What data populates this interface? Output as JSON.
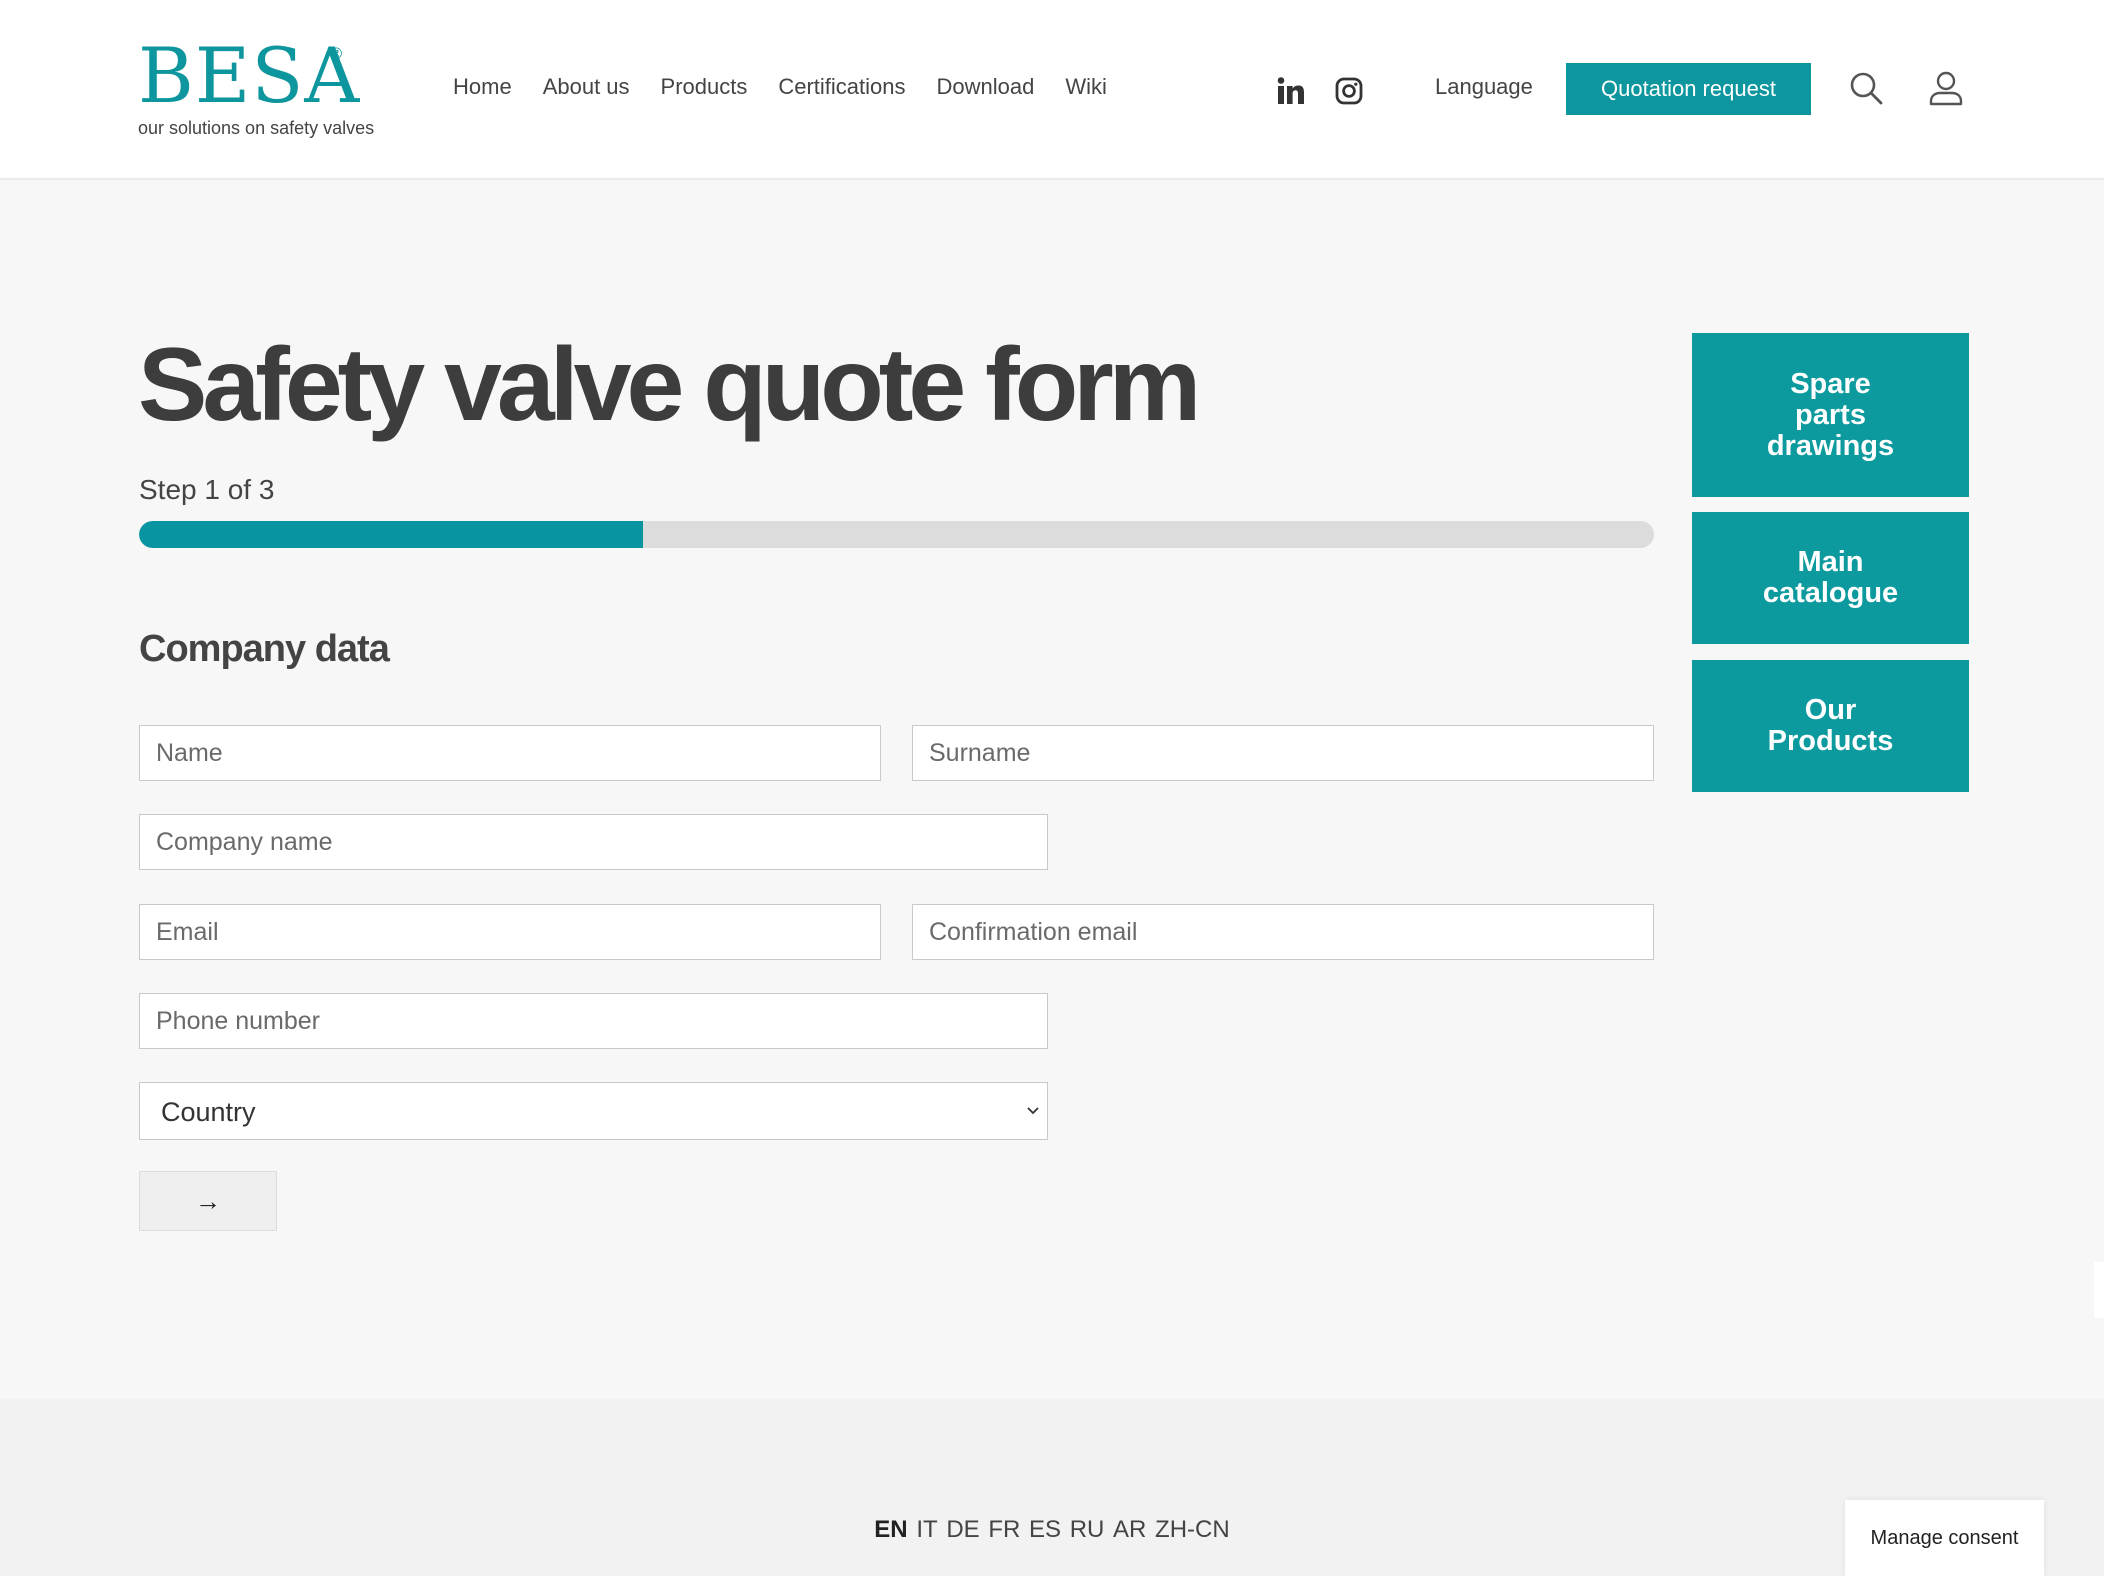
{
  "brand": {
    "name": "BESA",
    "reg": "®",
    "tagline": "our solutions on safety valves",
    "color": "#0d969d"
  },
  "nav": {
    "items": [
      "Home",
      "About us",
      "Products",
      "Certifications",
      "Download",
      "Wiki"
    ]
  },
  "social": {
    "icons": [
      "linkedin-icon",
      "instagram-icon"
    ]
  },
  "header": {
    "language_label": "Language",
    "quote_button": "Quotation request"
  },
  "form": {
    "title": "Safety valve quote form",
    "step_label": "Step 1 of 3",
    "progress_fraction": 0.333,
    "section_title": "Company data",
    "fields": {
      "name": {
        "placeholder": "Name",
        "value": ""
      },
      "surname": {
        "placeholder": "Surname",
        "value": ""
      },
      "company": {
        "placeholder": "Company name",
        "value": ""
      },
      "email": {
        "placeholder": "Email",
        "value": ""
      },
      "confirm_email": {
        "placeholder": "Confirmation email",
        "value": ""
      },
      "phone": {
        "placeholder": "Phone number",
        "value": ""
      }
    },
    "country": {
      "selected": "Country"
    },
    "next_button": "→"
  },
  "sidebar": {
    "tiles": [
      "Spare parts drawings",
      "Main catalogue",
      "Our Products"
    ]
  },
  "footer": {
    "languages": [
      "EN",
      "IT",
      "DE",
      "FR",
      "ES",
      "RU",
      "AR",
      "ZH-CN"
    ],
    "active_language": "EN",
    "consent_button": "Manage consent"
  }
}
